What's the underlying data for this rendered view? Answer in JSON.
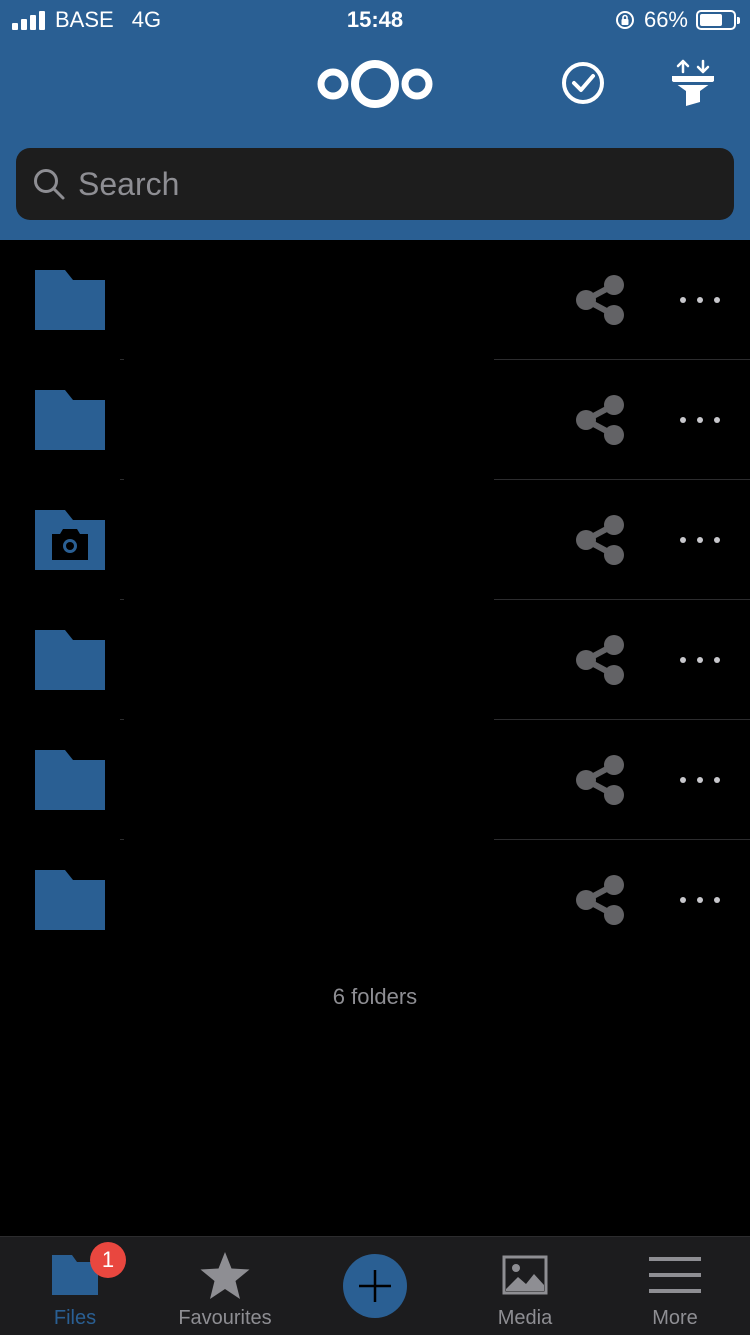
{
  "status_bar": {
    "carrier": "BASE",
    "network": "4G",
    "time": "15:48",
    "battery_percent": "66%",
    "battery_level": 0.66,
    "icons": [
      "signal-icon",
      "orientation-lock-icon",
      "battery-icon"
    ]
  },
  "header": {
    "logo": "nextcloud-logo-icon",
    "select_icon": "check-circle-icon",
    "sort_icon": "sort-filter-icon"
  },
  "search": {
    "placeholder": "Search"
  },
  "files": {
    "items": [
      {
        "type": "folder",
        "icon": "folder-icon"
      },
      {
        "type": "folder",
        "icon": "folder-icon"
      },
      {
        "type": "folder",
        "icon": "camera-folder-icon"
      },
      {
        "type": "folder",
        "icon": "folder-icon"
      },
      {
        "type": "folder",
        "icon": "folder-icon"
      },
      {
        "type": "folder",
        "icon": "folder-icon"
      }
    ],
    "summary": "6 folders"
  },
  "tabbar": {
    "files_label": "Files",
    "files_badge": "1",
    "favourites_label": "Favourites",
    "media_label": "Media",
    "more_label": "More"
  },
  "colors": {
    "brand": "#2a5f93",
    "background": "#000000",
    "badge": "#e9473f",
    "icon_gray": "#636366"
  }
}
